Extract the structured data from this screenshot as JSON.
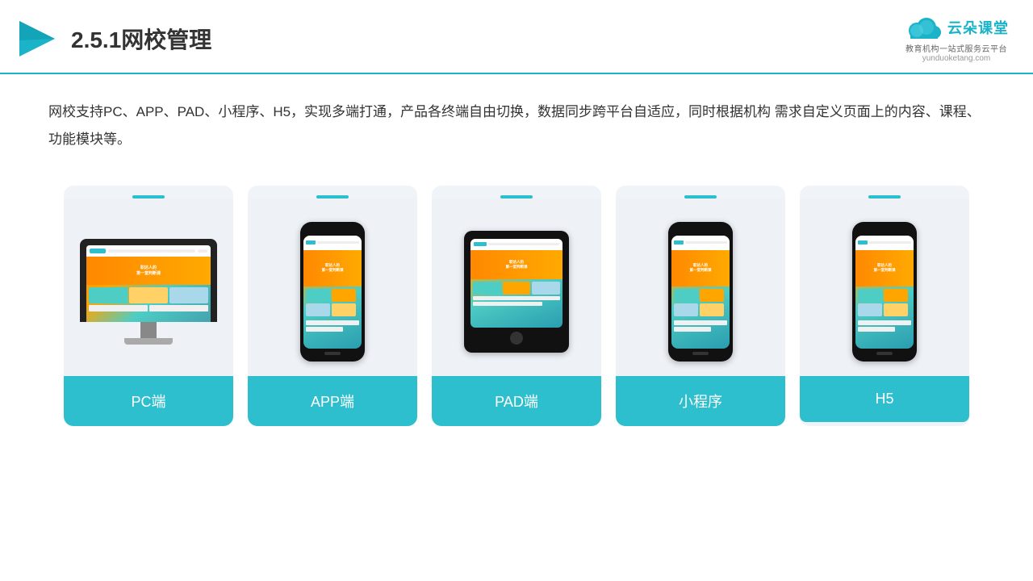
{
  "header": {
    "title": "2.5.1网校管理",
    "logo_main": "云朵课堂",
    "logo_url": "yunduoketang.com",
    "logo_tagline": "教育机构一站\n式服务云平台"
  },
  "description": "网校支持PC、APP、PAD、小程序、H5，实现多端打通，产品各终端自由切换，数据同步跨平台自适应，同时根据机构\n需求自定义页面上的内容、课程、功能模块等。",
  "cards": [
    {
      "id": "pc",
      "label": "PC端"
    },
    {
      "id": "app",
      "label": "APP端"
    },
    {
      "id": "pad",
      "label": "PAD端"
    },
    {
      "id": "mini",
      "label": "小程序"
    },
    {
      "id": "h5",
      "label": "H5"
    }
  ],
  "colors": {
    "accent": "#2dbfcd",
    "header_border": "#1ab3c8",
    "card_bg": "#eef2f7",
    "title_color": "#333333"
  }
}
